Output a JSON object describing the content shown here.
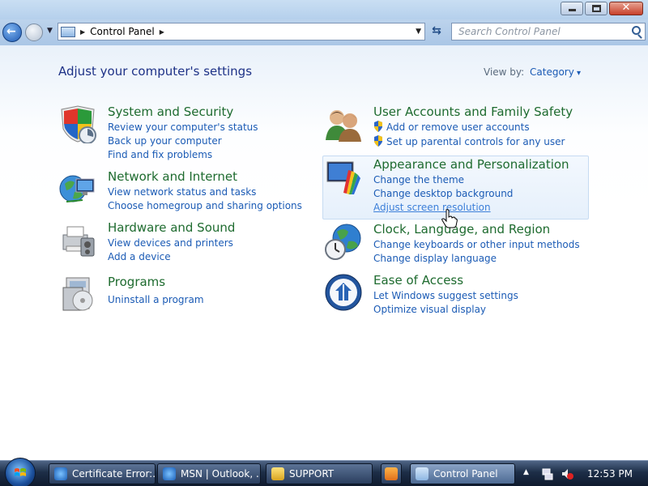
{
  "window": {
    "title": "Control Panel"
  },
  "address_bar": {
    "segments": [
      "Control Panel"
    ]
  },
  "search": {
    "placeholder": "Search Control Panel"
  },
  "header": {
    "heading": "Adjust your computer's settings",
    "view_by_label": "View by:",
    "view_by_value": "Category"
  },
  "categories": [
    {
      "title": "System and Security",
      "links": [
        "Review your computer's status",
        "Back up your computer",
        "Find and fix problems"
      ]
    },
    {
      "title": "Network and Internet",
      "links": [
        "View network status and tasks",
        "Choose homegroup and sharing options"
      ]
    },
    {
      "title": "Hardware and Sound",
      "links": [
        "View devices and printers",
        "Add a device"
      ]
    },
    {
      "title": "Programs",
      "links": [
        "Uninstall a program"
      ]
    },
    {
      "title": "User Accounts and Family Safety",
      "links": [
        "Add or remove user accounts",
        "Set up parental controls for any user"
      ]
    },
    {
      "title": "Appearance and Personalization",
      "links": [
        "Change the theme",
        "Change desktop background",
        "Adjust screen resolution"
      ]
    },
    {
      "title": "Clock, Language, and Region",
      "links": [
        "Change keyboards or other input methods",
        "Change display language"
      ]
    },
    {
      "title": "Ease of Access",
      "links": [
        "Let Windows suggest settings",
        "Optimize visual display"
      ]
    }
  ],
  "taskbar": {
    "buttons": [
      "Certificate Error:...",
      "MSN | Outlook, ...",
      "SUPPORT",
      "Control Panel"
    ],
    "clock": "12:53 PM"
  },
  "colors": {
    "link": "#1b5bb5",
    "category_title": "#1e6b2f",
    "heading": "#1e3287"
  }
}
